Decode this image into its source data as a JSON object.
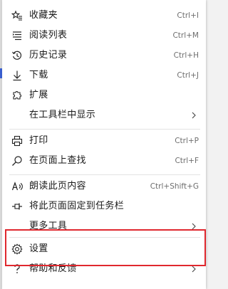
{
  "menu": {
    "items": [
      {
        "label": "收藏夹",
        "shortcut": "Ctrl+I",
        "icon": "favorites-star-icon"
      },
      {
        "label": "阅读列表",
        "shortcut": "Ctrl+M",
        "icon": "reading-list-icon"
      },
      {
        "label": "历史记录",
        "shortcut": "Ctrl+H",
        "icon": "history-icon"
      },
      {
        "label": "下载",
        "shortcut": "Ctrl+J",
        "icon": "download-icon"
      },
      {
        "label": "扩展",
        "shortcut": "",
        "icon": "extensions-icon"
      },
      {
        "label": "在工具栏中显示",
        "shortcut": "",
        "icon": "",
        "submenu": true
      },
      {
        "label": "打印",
        "shortcut": "Ctrl+P",
        "icon": "print-icon"
      },
      {
        "label": "在页面上查找",
        "shortcut": "Ctrl+F",
        "icon": "find-search-icon"
      },
      {
        "label": "朗读此页内容",
        "shortcut": "Ctrl+Shift+G",
        "icon": "read-aloud-icon"
      },
      {
        "label": "将此页面固定到任务栏",
        "shortcut": "",
        "icon": "pin-taskbar-icon"
      },
      {
        "label": "更多工具",
        "shortcut": "",
        "icon": "",
        "submenu": true
      },
      {
        "label": "设置",
        "shortcut": "",
        "icon": "settings-gear-icon"
      },
      {
        "label": "帮助和反馈",
        "shortcut": "",
        "icon": "help-question-icon",
        "submenu": true
      }
    ]
  },
  "colors": {
    "highlight_border": "#e0282e",
    "sidebar_accent": "#3a5fd0"
  }
}
